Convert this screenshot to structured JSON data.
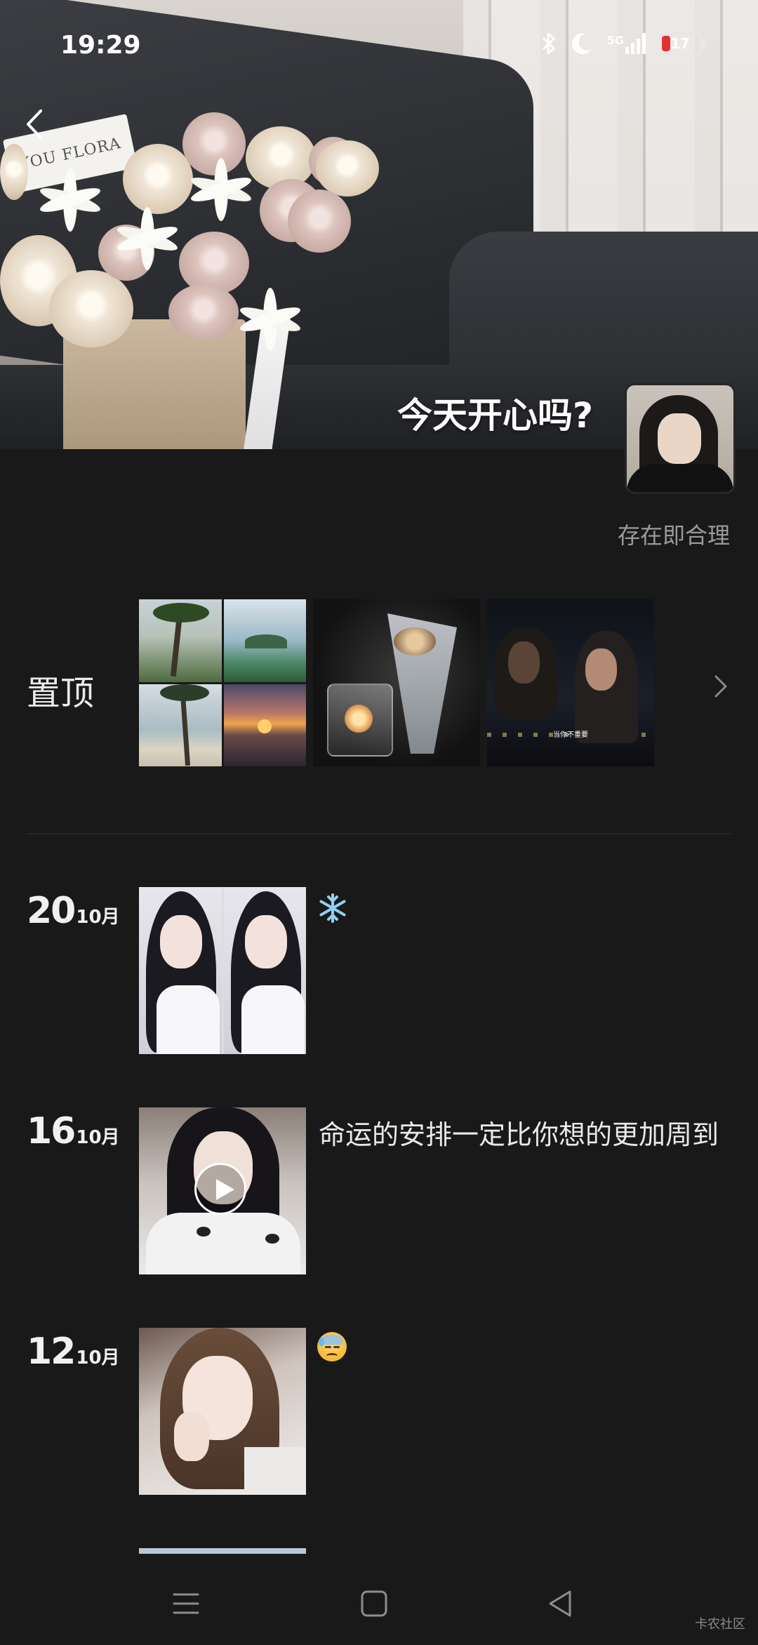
{
  "status_bar": {
    "time": "19:29",
    "network": "5G",
    "battery_level": "17",
    "icons": [
      "bluetooth-icon",
      "moon-icon",
      "signal-icon",
      "battery-icon"
    ]
  },
  "cover": {
    "title": "今天开心吗?",
    "card_text": "YOU FLORA"
  },
  "profile": {
    "signature": "存在即合理"
  },
  "pinned": {
    "label": "置顶",
    "video_caption": "当你不重要"
  },
  "posts": [
    {
      "day": "20",
      "month": "10月",
      "text": "",
      "emoji": "snowflake-icon"
    },
    {
      "day": "16",
      "month": "10月",
      "text": "命运的安排一定比你想的更加周到",
      "is_video": true
    },
    {
      "day": "12",
      "month": "10月",
      "text": "",
      "emoji": "sweat-face-icon"
    }
  ],
  "watermark": "卡农社区",
  "colors": {
    "background": "#191919",
    "text_primary": "#e9e9e9",
    "text_secondary": "#9a9a9a",
    "battery_low": "#e0332f"
  }
}
